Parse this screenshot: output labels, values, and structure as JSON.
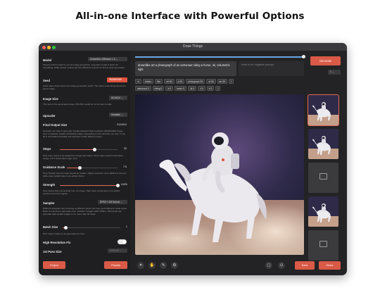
{
  "headline": "All-in-one Interface with  Powerful Options",
  "window": {
    "title": "Draw Things"
  },
  "sidebar": {
    "model": {
      "label": "Model",
      "value": "DreamBox Diffusion 1.0 ⌄",
      "desc": "Choose which model to use for image generation. A generic model is better for everything, while certain models (as fine-diffusion) is good for anime style generation."
    },
    "seed": {
      "label": "Seed",
      "value": "993690080",
      "desc": "Seed value determines how image generation starts. The same seed will generate the same image."
    },
    "image_size": {
      "label": "Image Size",
      "value": "512x512 ⌄",
      "desc": "The size of the generated image. 512x512 would be for the best results."
    },
    "upscaler": {
      "label": "Upscaler",
      "value": "Disabled ⌄"
    },
    "final_output": {
      "label": "Final Output Size",
      "value": "512x512",
      "desc": "Upscaler can help to generate visually pleasant high resolution (2048x2048) image from a relatively smaller (512x512) image. Depending on the upscaler you use, it may fill in with different details and introduce subtly different styles."
    },
    "steps": {
      "label": "Steps",
      "value": "30",
      "fraction": 0.6,
      "desc": "How many steps to be applied for image generation. More steps would result better image, but it would take longer time."
    },
    "guidance": {
      "label": "Guidance Scale",
      "value": "7.5",
      "fraction": 0.25,
      "desc": "How \"Strictly\" the text input should be treated. Higher would be more faithful to the text while lower would have more artistic liberty."
    },
    "strength": {
      "label": "Strength",
      "value": "100%",
      "fraction": 1.0,
      "desc": "Only useful when generating from an image. High value would give more artistic freedom from the original."
    },
    "sampler": {
      "label": "Sampler",
      "value": "DPM++ 2M Karras ⌄",
      "desc": "Different samplers can converge at different steps and may result different visual styles. Euler A is known to generate more \"creative\" images while DPM++ 2M Karras can generate high quality images in no more than 30 steps."
    },
    "batch": {
      "label": "Batch Size",
      "value": "1",
      "fraction": 0.05,
      "desc": "How many images to be generated at once."
    },
    "hires": {
      "label": "High Resolution Fix"
    },
    "first_pass": {
      "label": "1st Pass Size",
      "value": "448x448 ⌄"
    },
    "project_btn": "Project",
    "presets_btn": "Presets"
  },
  "prompt": {
    "text": "dreamlike art a photograph of an astronaut riding a horse, 4k, volumetric light",
    "negative_placeholder": "Here is for negative prompt",
    "tags_row1": [
      "⊙",
      "dream",
      "like",
      "art 65",
      "a 65",
      "photograph 95",
      "of 65",
      "an 65",
      "⌉"
    ],
    "tags_row2": [
      "astronaut 9",
      "riding 9",
      "a 9",
      "horse 9",
      "4k 9",
      "4 9",
      "k 9",
      "⌉"
    ]
  },
  "generate_btn": "Generate",
  "count_select": "1 ⌄",
  "toolbar": {
    "icons": [
      "✦",
      "✋",
      "✎",
      "⚙"
    ],
    "right_icons": [
      "▢",
      "⊙"
    ],
    "save": "Save",
    "share": "Share"
  },
  "thumbnails": [
    {
      "kind": "image",
      "selected": true
    },
    {
      "kind": "image",
      "selected": false
    },
    {
      "kind": "placeholder",
      "selected": false
    },
    {
      "kind": "image",
      "selected": false
    },
    {
      "kind": "placeholder",
      "selected": false
    }
  ],
  "colors": {
    "accent": "#d95a47",
    "window_bg": "#232325",
    "sidebar_bg": "#1f1f21"
  }
}
